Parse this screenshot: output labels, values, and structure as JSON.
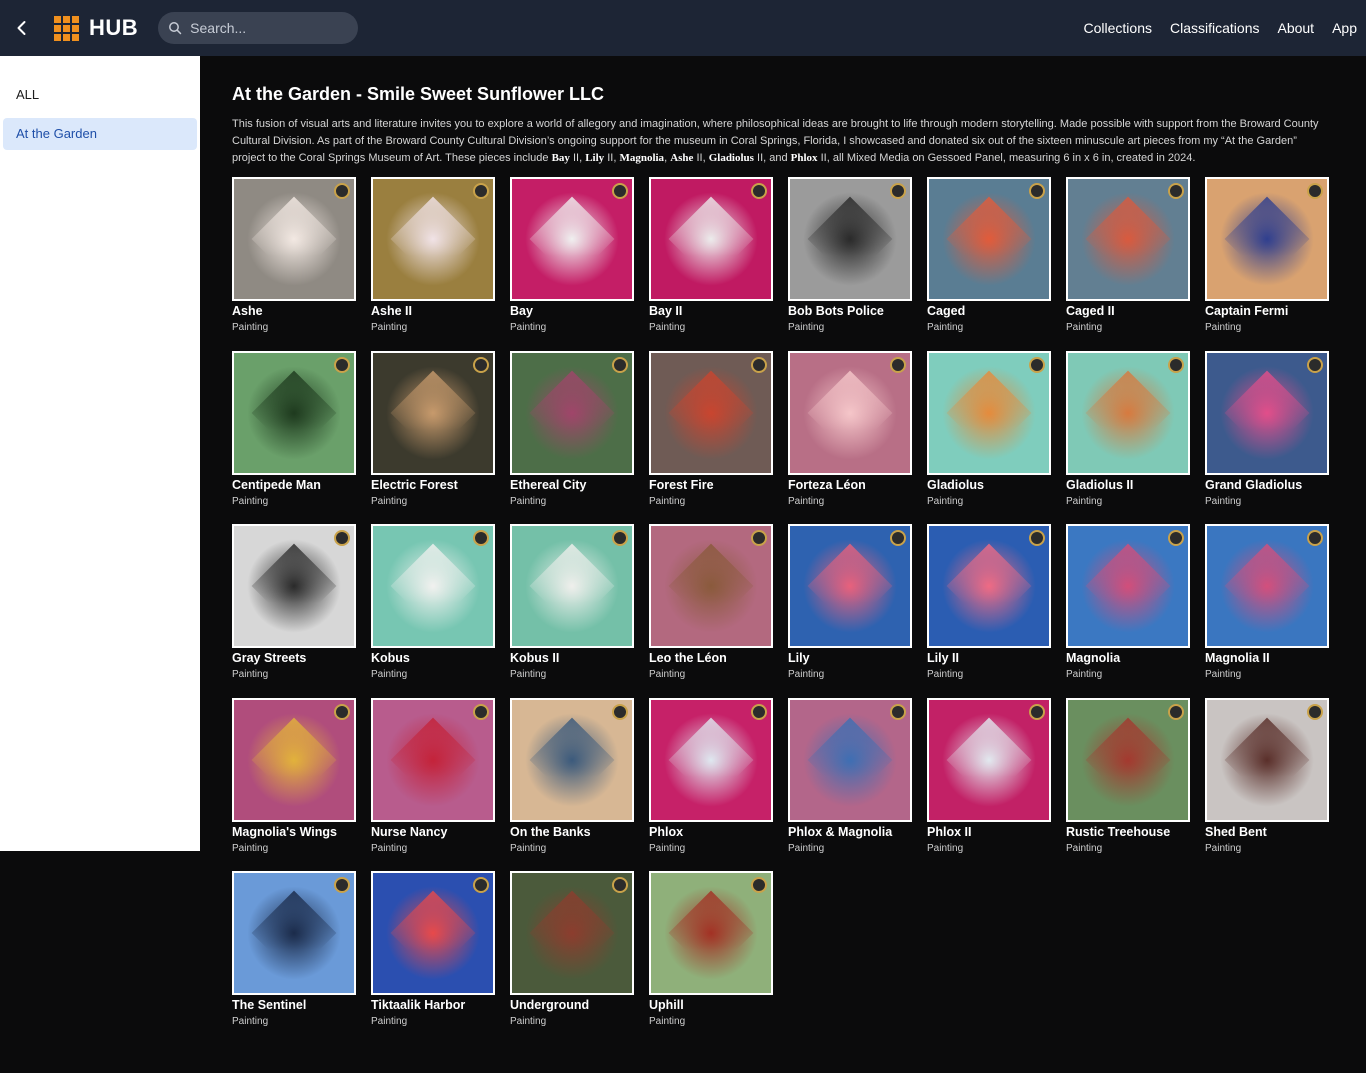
{
  "header": {
    "brand": "HUB",
    "search_placeholder": "Search...",
    "nav": [
      "Collections",
      "Classifications",
      "About",
      "App"
    ]
  },
  "sidebar": {
    "items": [
      {
        "label": "ALL"
      },
      {
        "label": "At the Garden"
      }
    ]
  },
  "main": {
    "title": "At the Garden - Smile Sweet Sunflower LLC",
    "description_parts": {
      "p1": "This fusion of visual arts and literature invites you to explore a world of allegory and imagination, where philosophical ideas are brought to life through modern storytelling. Made possible with support from the Broward County Cultural Division. As part of the Broward County Cultural Division’s ongoing support for the museum in Coral Springs, Florida, I showcased and donated six out of the sixteen minuscule art pieces from my “At the Garden” project to the Coral Springs Museum of Art. These pieces include ",
      "b1": "Bay",
      "p2": " II, ",
      "b2": "Lily",
      "p3": " II, ",
      "b3": "Magnolia",
      "p4": ", ",
      "b4": "Ashe",
      "p5": " II, ",
      "b5": "Gladiolus",
      "p6": " II, and ",
      "b6": "Phlox",
      "p7": " II, all Mixed Media on Gessoed Panel, measuring 6 in x 6 in, created in 2024."
    },
    "items": [
      {
        "title": "Ashe",
        "type": "Painting",
        "bg": "#8f8a83",
        "fg": "#f3e9e3"
      },
      {
        "title": "Ashe II",
        "type": "Painting",
        "bg": "#9a7f3f",
        "fg": "#f1e3e7"
      },
      {
        "title": "Bay",
        "type": "Painting",
        "bg": "#c41e66",
        "fg": "#f0f0f0"
      },
      {
        "title": "Bay II",
        "type": "Painting",
        "bg": "#c01a62",
        "fg": "#ececec"
      },
      {
        "title": "Bob Bots Police",
        "type": "Painting",
        "bg": "#9b9b9b",
        "fg": "#2a2a2a"
      },
      {
        "title": "Caged",
        "type": "Painting",
        "bg": "#5a7d93",
        "fg": "#e25b3a"
      },
      {
        "title": "Caged II",
        "type": "Painting",
        "bg": "#627f92",
        "fg": "#d95a3e"
      },
      {
        "title": "Captain Fermi",
        "type": "Painting",
        "bg": "#d9a270",
        "fg": "#2f3f8f"
      },
      {
        "title": "Centipede Man",
        "type": "Painting",
        "bg": "#6aa06a",
        "fg": "#1e3a1e"
      },
      {
        "title": "Electric Forest",
        "type": "Painting",
        "bg": "#3c3a2d",
        "fg": "#c79a6c"
      },
      {
        "title": "Ethereal City",
        "type": "Painting",
        "bg": "#4d6e48",
        "fg": "#a0456a"
      },
      {
        "title": "Forest Fire",
        "type": "Painting",
        "bg": "#6f5b55",
        "fg": "#c9452f"
      },
      {
        "title": "Forteza Léon",
        "type": "Painting",
        "bg": "#b86f86",
        "fg": "#f5c6c9"
      },
      {
        "title": "Gladiolus",
        "type": "Painting",
        "bg": "#7fcdbd",
        "fg": "#e58b3c"
      },
      {
        "title": "Gladiolus II",
        "type": "Painting",
        "bg": "#7fc9b6",
        "fg": "#d77a3f"
      },
      {
        "title": "Grand Gladiolus",
        "type": "Painting",
        "bg": "#3d5a8d",
        "fg": "#e24e8a"
      },
      {
        "title": "Gray Streets",
        "type": "Painting",
        "bg": "#d7d7d7",
        "fg": "#2a2a2a"
      },
      {
        "title": "Kobus",
        "type": "Painting",
        "bg": "#77c6b2",
        "fg": "#f1f1ef"
      },
      {
        "title": "Kobus II",
        "type": "Painting",
        "bg": "#74c0a8",
        "fg": "#efefec"
      },
      {
        "title": "Leo the Léon",
        "type": "Painting",
        "bg": "#b3697f",
        "fg": "#8a5a3c"
      },
      {
        "title": "Lily",
        "type": "Painting",
        "bg": "#2e62b0",
        "fg": "#e8617c"
      },
      {
        "title": "Lily II",
        "type": "Painting",
        "bg": "#2b5db2",
        "fg": "#ef6b84"
      },
      {
        "title": "Magnolia",
        "type": "Painting",
        "bg": "#3b78c2",
        "fg": "#d24e7a"
      },
      {
        "title": "Magnolia II",
        "type": "Painting",
        "bg": "#3a76c0",
        "fg": "#d34f7c"
      },
      {
        "title": "Magnolia's Wings",
        "type": "Painting",
        "bg": "#b04d7c",
        "fg": "#e2b23b"
      },
      {
        "title": "Nurse Nancy",
        "type": "Painting",
        "bg": "#b85c8d",
        "fg": "#c4233a"
      },
      {
        "title": "On the Banks",
        "type": "Painting",
        "bg": "#d7b794",
        "fg": "#3b5a7c"
      },
      {
        "title": "Phlox",
        "type": "Painting",
        "bg": "#c62168",
        "fg": "#dfe8f0"
      },
      {
        "title": "Phlox & Magnolia",
        "type": "Painting",
        "bg": "#b3668a",
        "fg": "#3e6fb3"
      },
      {
        "title": "Phlox II",
        "type": "Painting",
        "bg": "#c22166",
        "fg": "#e2e9ef"
      },
      {
        "title": "Rustic Treehouse",
        "type": "Painting",
        "bg": "#6a8f5f",
        "fg": "#a4392f"
      },
      {
        "title": "Shed Bent",
        "type": "Painting",
        "bg": "#c9c4c2",
        "fg": "#5a2f2a"
      },
      {
        "title": "The Sentinel",
        "type": "Painting",
        "bg": "#6a9ad8",
        "fg": "#1b2b4a"
      },
      {
        "title": "Tiktaalik Harbor",
        "type": "Painting",
        "bg": "#2b4fb0",
        "fg": "#e8494a"
      },
      {
        "title": "Underground",
        "type": "Painting",
        "bg": "#4b5a3b",
        "fg": "#8c3d2e"
      },
      {
        "title": "Uphill",
        "type": "Painting",
        "bg": "#8fb07a",
        "fg": "#a33124"
      }
    ]
  }
}
